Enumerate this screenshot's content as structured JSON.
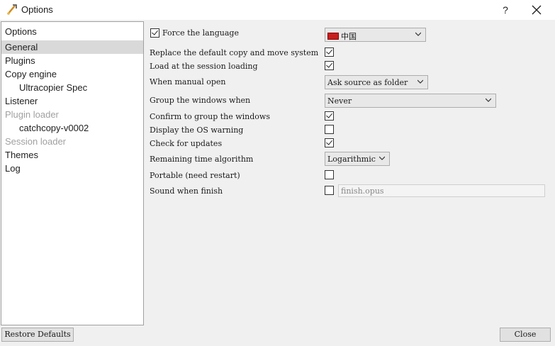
{
  "window": {
    "title": "Options",
    "help_label": "?"
  },
  "sidebar": {
    "items": [
      {
        "label": "Options"
      },
      {
        "label": "General"
      },
      {
        "label": "Plugins"
      },
      {
        "label": "Copy engine"
      },
      {
        "label": "Ultracopier Spec"
      },
      {
        "label": "Listener"
      },
      {
        "label": "Plugin loader"
      },
      {
        "label": "catchcopy-v0002"
      },
      {
        "label": "Session loader"
      },
      {
        "label": "Themes"
      },
      {
        "label": "Log"
      }
    ]
  },
  "general": {
    "force_language": {
      "label": "Force the language",
      "checked": true
    },
    "language_select": {
      "value": "中国"
    },
    "replace_copy_move": {
      "label": "Replace the default copy and move system",
      "checked": true
    },
    "load_session": {
      "label": "Load at the session loading",
      "checked": true
    },
    "manual_open": {
      "label": "When manual open",
      "value": "Ask source as folder"
    },
    "group_windows": {
      "label": "Group the windows when",
      "value": "Never"
    },
    "confirm_group": {
      "label": "Confirm to group the windows",
      "checked": true
    },
    "os_warning": {
      "label": "Display the OS warning",
      "checked": false
    },
    "check_updates": {
      "label": "Check for updates",
      "checked": true
    },
    "remaining_time": {
      "label": "Remaining time algorithm",
      "value": "Logarithmic"
    },
    "portable": {
      "label": "Portable (need restart)",
      "checked": false
    },
    "sound_finish": {
      "label": "Sound when finish",
      "checked": false,
      "file": "finish.opus"
    }
  },
  "buttons": {
    "restore_defaults": "Restore Defaults",
    "close": "Close"
  }
}
